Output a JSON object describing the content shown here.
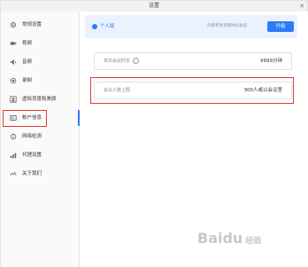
{
  "window": {
    "title": "设置",
    "close_glyph": "✕"
  },
  "sidebar": {
    "items": [
      {
        "label": "常规设置",
        "icon": "gear-icon"
      },
      {
        "label": "视频",
        "icon": "video-icon"
      },
      {
        "label": "音频",
        "icon": "speaker-icon"
      },
      {
        "label": "录制",
        "icon": "record-icon"
      },
      {
        "label": "虚拟背景和美颜",
        "icon": "person-icon"
      },
      {
        "label": "帐户信息",
        "icon": "account-icon",
        "active": true
      },
      {
        "label": "网络检测",
        "icon": "network-icon"
      },
      {
        "label": "代理设置",
        "icon": "proxy-icon"
      },
      {
        "label": "关于我们",
        "icon": "about-icon"
      }
    ]
  },
  "banner": {
    "account_type": "个人版",
    "hint": "升级专享无限时长会议",
    "upgrade_label": "升级"
  },
  "rows": [
    {
      "label": "单次会议时长",
      "value": "9999分钟"
    },
    {
      "label": "会议人数上限",
      "value": "300人或以会议室"
    }
  ],
  "watermark": {
    "main": "Baidu",
    "sub": "经验"
  },
  "colors": {
    "accent": "#2d7cf6",
    "highlight": "#e13a3a"
  }
}
